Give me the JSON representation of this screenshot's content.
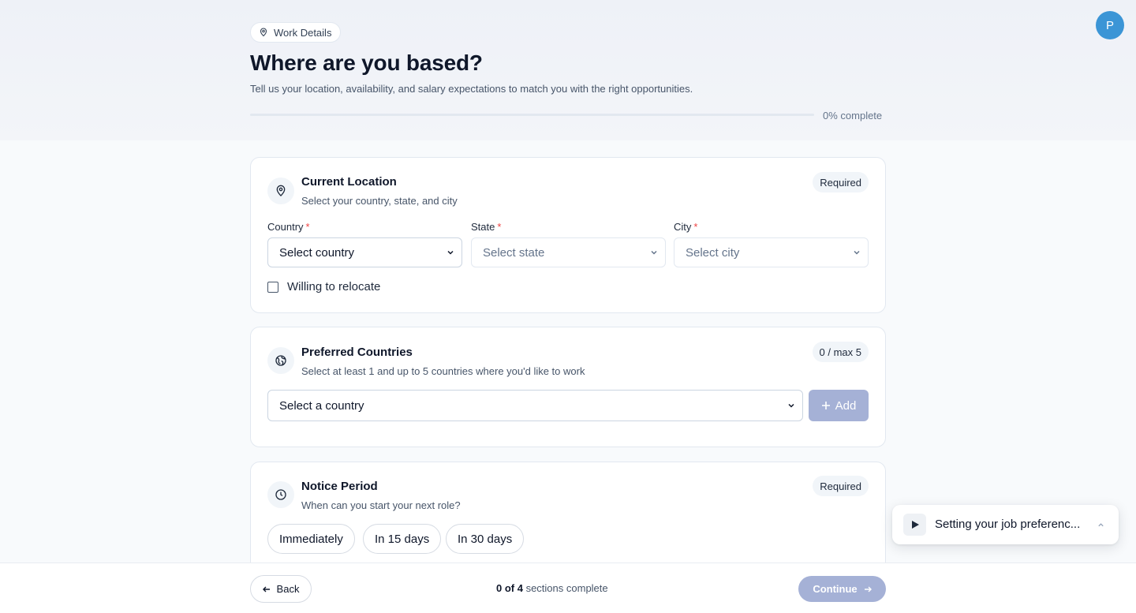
{
  "header": {
    "breadcrumb_label": "Work Details",
    "title": "Where are you based?",
    "subtitle": "Tell us your location, availability, and salary expectations to match you with the right opportunities.",
    "progress_percent": 0,
    "progress_label": "0% complete",
    "avatar_initial": "P"
  },
  "location_card": {
    "title": "Current Location",
    "description": "Select your country, state, and city",
    "badge": "Required",
    "country_label": "Country",
    "state_label": "State",
    "city_label": "City",
    "required_mark": "*",
    "country_value": "Select country",
    "state_value": "Select state",
    "city_value": "Select city",
    "relocate_label": "Willing to relocate",
    "relocate_checked": false
  },
  "countries_card": {
    "title": "Preferred Countries",
    "description": "Select at least 1 and up to 5 countries where you'd like to work",
    "badge": "0 / max 5",
    "select_value": "Select a country",
    "add_label": "Add"
  },
  "notice_card": {
    "title": "Notice Period",
    "description": "When can you start your next role?",
    "badge": "Required",
    "options": [
      "Immediately",
      "In 15 days",
      "In 30 days"
    ]
  },
  "footer": {
    "back_label": "Back",
    "status_count": "0 of 4",
    "status_suffix": " sections complete",
    "continue_label": "Continue"
  },
  "toast": {
    "text": "Setting your job preferenc..."
  },
  "colors": {
    "accent_disabled": "#a5b1d6",
    "avatar": "#3b95d6",
    "required": "#ef4444"
  }
}
